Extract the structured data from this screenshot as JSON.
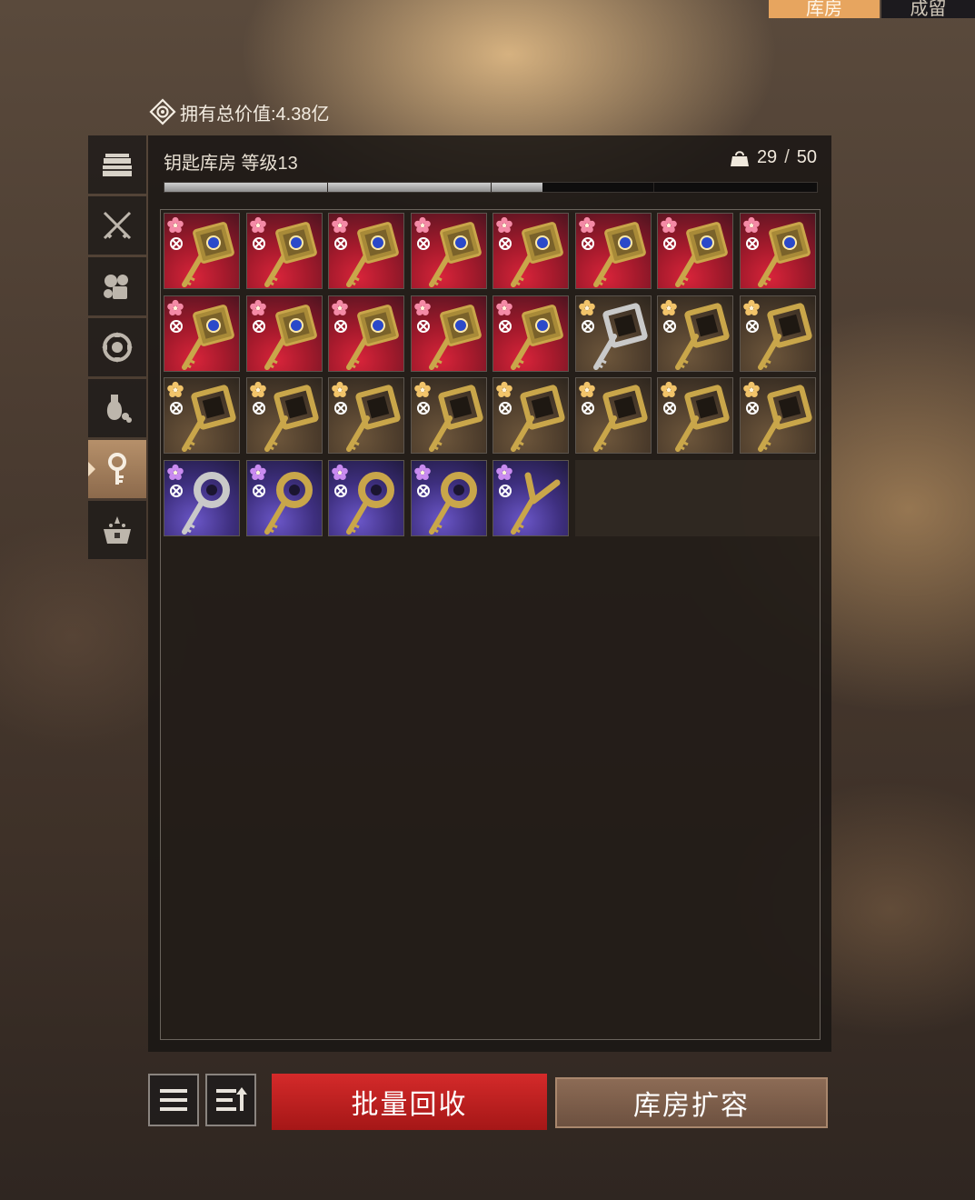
{
  "top_tabs": [
    {
      "label": "库房",
      "active": true
    },
    {
      "label": "成留",
      "active": false
    }
  ],
  "total_value": {
    "label": "拥有总价值:4.38亿",
    "icon": "eye-icon"
  },
  "side_tabs": [
    {
      "icon": "chest-icon",
      "active": false
    },
    {
      "icon": "crossed-swords-icon",
      "active": false
    },
    {
      "icon": "materials-icon",
      "active": false
    },
    {
      "icon": "gear-orb-icon",
      "active": false
    },
    {
      "icon": "potion-icon",
      "active": false
    },
    {
      "icon": "key-icon",
      "active": true
    },
    {
      "icon": "treasure-box-icon",
      "active": false
    }
  ],
  "panel": {
    "title": "钥匙库房 等级13",
    "capacity": {
      "used": "29",
      "separator": "/",
      "total": "50",
      "icon": "bag-icon"
    },
    "fill_fraction": 0.58
  },
  "items": [
    {
      "rarity": "red",
      "key": "gold-square-blue-gem-key"
    },
    {
      "rarity": "red",
      "key": "gold-square-blue-gem-key"
    },
    {
      "rarity": "red",
      "key": "gold-square-blue-gem-key"
    },
    {
      "rarity": "red",
      "key": "gold-square-blue-gem-key"
    },
    {
      "rarity": "red",
      "key": "gold-square-blue-gem-key"
    },
    {
      "rarity": "red",
      "key": "gold-square-blue-gem-key"
    },
    {
      "rarity": "red",
      "key": "gold-square-blue-gem-key"
    },
    {
      "rarity": "red",
      "key": "gold-square-blue-gem-key"
    },
    {
      "rarity": "red",
      "key": "gold-square-blue-gem-key"
    },
    {
      "rarity": "red",
      "key": "gold-square-blue-gem-key"
    },
    {
      "rarity": "red",
      "key": "gold-square-blue-gem-key"
    },
    {
      "rarity": "red",
      "key": "gold-square-blue-gem-key"
    },
    {
      "rarity": "red",
      "key": "gold-square-blue-gem-key"
    },
    {
      "rarity": "gold",
      "key": "silver-frame-key"
    },
    {
      "rarity": "gold",
      "key": "gold-frame-key"
    },
    {
      "rarity": "gold",
      "key": "gold-frame-key"
    },
    {
      "rarity": "gold",
      "key": "gold-frame-key"
    },
    {
      "rarity": "gold",
      "key": "gold-frame-key"
    },
    {
      "rarity": "gold",
      "key": "gold-frame-key"
    },
    {
      "rarity": "gold",
      "key": "gold-frame-key"
    },
    {
      "rarity": "gold",
      "key": "gold-frame-key"
    },
    {
      "rarity": "gold",
      "key": "gold-frame-key"
    },
    {
      "rarity": "gold",
      "key": "gold-frame-key"
    },
    {
      "rarity": "gold",
      "key": "gold-frame-key"
    },
    {
      "rarity": "purple",
      "key": "silver-ring-key"
    },
    {
      "rarity": "purple",
      "key": "gold-ring-key"
    },
    {
      "rarity": "purple",
      "key": "gold-ring-key"
    },
    {
      "rarity": "purple",
      "key": "gold-ring-key"
    },
    {
      "rarity": "purple",
      "key": "gold-fork-key"
    }
  ],
  "colors": {
    "red_flower": "#f48aa6",
    "gold_flower": "#f2c46a",
    "purple_flower": "#c98bf0",
    "gold_key": "#c9a64a",
    "silver_key": "#c9c9c9",
    "gem": "#2b49c9"
  },
  "toolbar": {
    "list_icon": "list-icon",
    "sort_icon": "sort-icon",
    "recycle_label": "批量回收",
    "expand_label": "库房扩容"
  }
}
